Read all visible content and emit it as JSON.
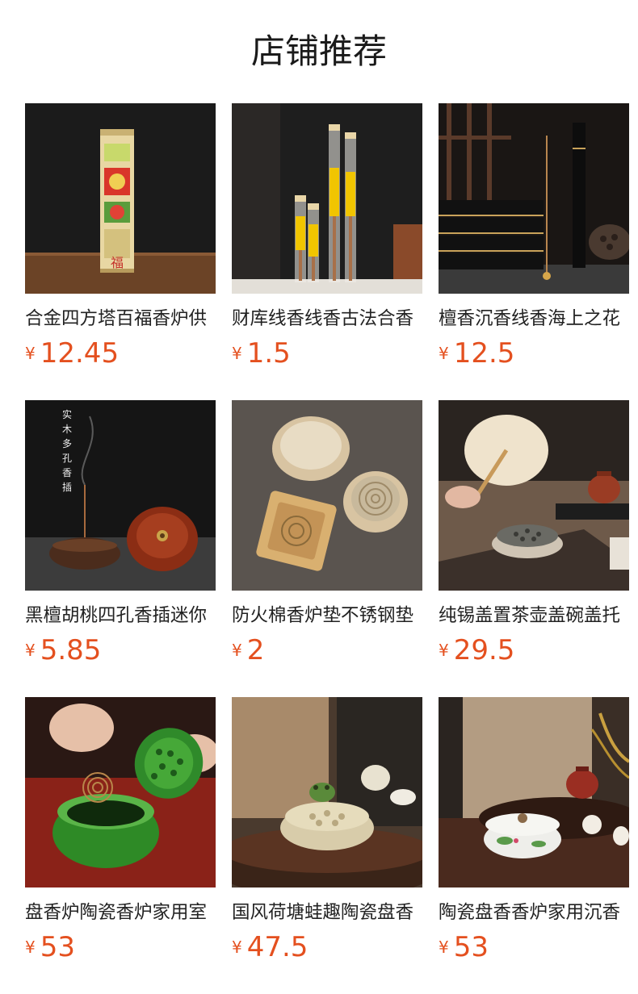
{
  "section_title": "店铺推荐",
  "currency_symbol": "¥",
  "colors": {
    "price": "#e4501f",
    "title": "#1a1a1a",
    "name": "#222222"
  },
  "products": [
    {
      "name": "合金四方塔百福香炉供",
      "price": "12.45",
      "image": "incense-tower-burner"
    },
    {
      "name": "财库线香线香古法合香",
      "price": "1.5",
      "image": "incense-sticks-tubes"
    },
    {
      "name": "檀香沉香线香海上之花",
      "price": "12.5",
      "image": "incense-boxes"
    },
    {
      "name": "黑檀胡桃四孔香插迷你",
      "price": "5.85",
      "image": "wooden-incense-holder"
    },
    {
      "name": "防火棉香炉垫不锈钢垫",
      "price": "2",
      "image": "incense-burner-mats"
    },
    {
      "name": "纯锡盖置茶壶盖碗盖托",
      "price": "29.5",
      "image": "tin-lid-burner"
    },
    {
      "name": "盘香炉陶瓷香炉家用室",
      "price": "53",
      "image": "green-ceramic-burner"
    },
    {
      "name": "国风荷塘蛙趣陶瓷盘香",
      "price": "47.5",
      "image": "lotus-frog-burner"
    },
    {
      "name": "陶瓷盘香香炉家用沉香",
      "price": "53",
      "image": "white-ceramic-burner"
    }
  ]
}
